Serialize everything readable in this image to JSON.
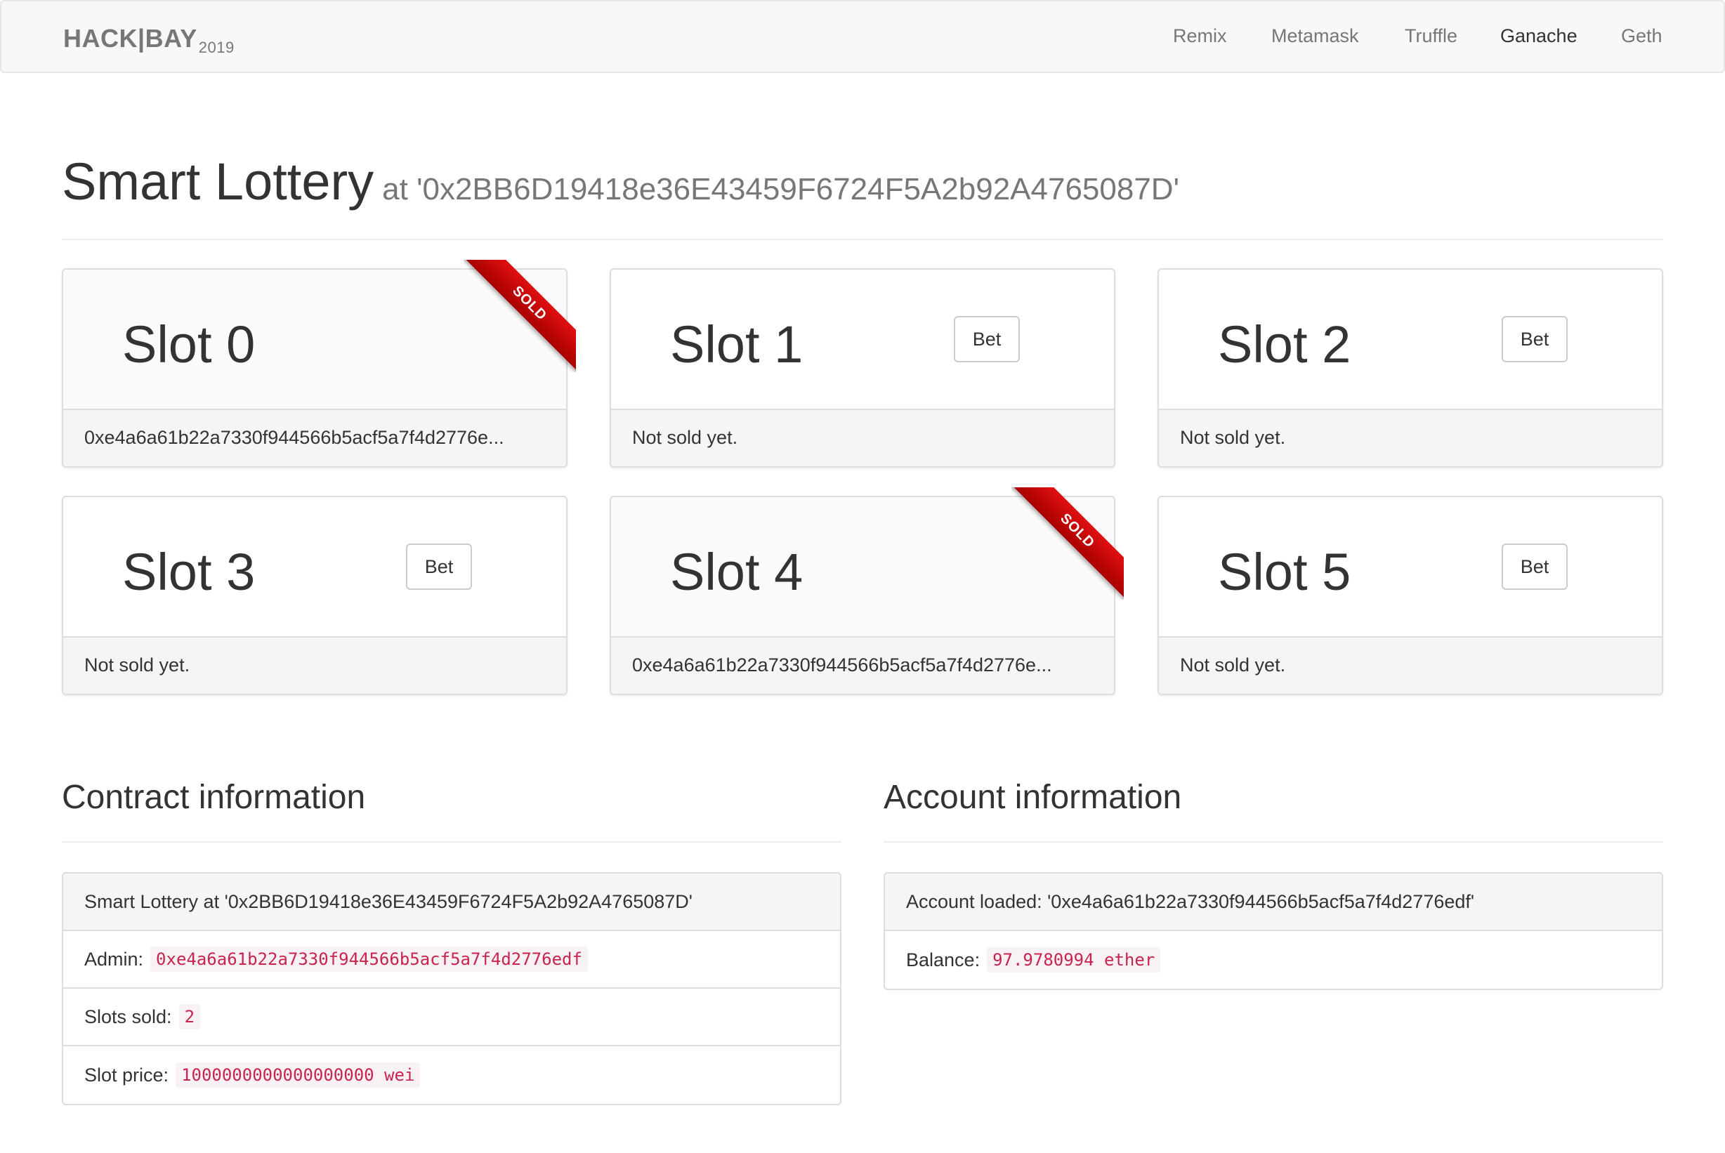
{
  "nav": {
    "brand": "HACK|BAY",
    "brand_year": "2019",
    "links": [
      "Remix",
      "Metamask",
      "Truffle",
      "Ganache",
      "Geth"
    ],
    "active": "Ganache"
  },
  "header": {
    "title": "Smart Lottery",
    "subtitle": "at '0x2BB6D19418e36E43459F6724F5A2b92A4765087D'"
  },
  "slots": [
    {
      "name": "Slot 0",
      "sold": true,
      "ribbon": "SOLD",
      "footer": "0xe4a6a61b22a7330f944566b5acf5a7f4d2776e..."
    },
    {
      "name": "Slot 1",
      "sold": false,
      "button": "Bet",
      "footer": "Not sold yet."
    },
    {
      "name": "Slot 2",
      "sold": false,
      "button": "Bet",
      "footer": "Not sold yet."
    },
    {
      "name": "Slot 3",
      "sold": false,
      "button": "Bet",
      "footer": "Not sold yet."
    },
    {
      "name": "Slot 4",
      "sold": true,
      "ribbon": "SOLD",
      "footer": "0xe4a6a61b22a7330f944566b5acf5a7f4d2776e..."
    },
    {
      "name": "Slot 5",
      "sold": false,
      "button": "Bet",
      "footer": "Not sold yet."
    }
  ],
  "contract": {
    "title": "Contract information",
    "heading": "Smart Lottery at '0x2BB6D19418e36E43459F6724F5A2b92A4765087D'",
    "admin_label": "Admin:",
    "admin_value": "0xe4a6a61b22a7330f944566b5acf5a7f4d2776edf",
    "slots_sold_label": "Slots sold:",
    "slots_sold_value": "2",
    "slot_price_label": "Slot price:",
    "slot_price_value": "1000000000000000000 wei"
  },
  "account": {
    "title": "Account information",
    "heading": "Account loaded: '0xe4a6a61b22a7330f944566b5acf5a7f4d2776edf'",
    "balance_label": "Balance:",
    "balance_value": "97.9780994 ether"
  },
  "colors": {
    "ribbon": "#c00000",
    "code_text": "#c7254e",
    "code_bg": "#f9f2f4",
    "panel_footer_bg": "#f5f5f5"
  }
}
